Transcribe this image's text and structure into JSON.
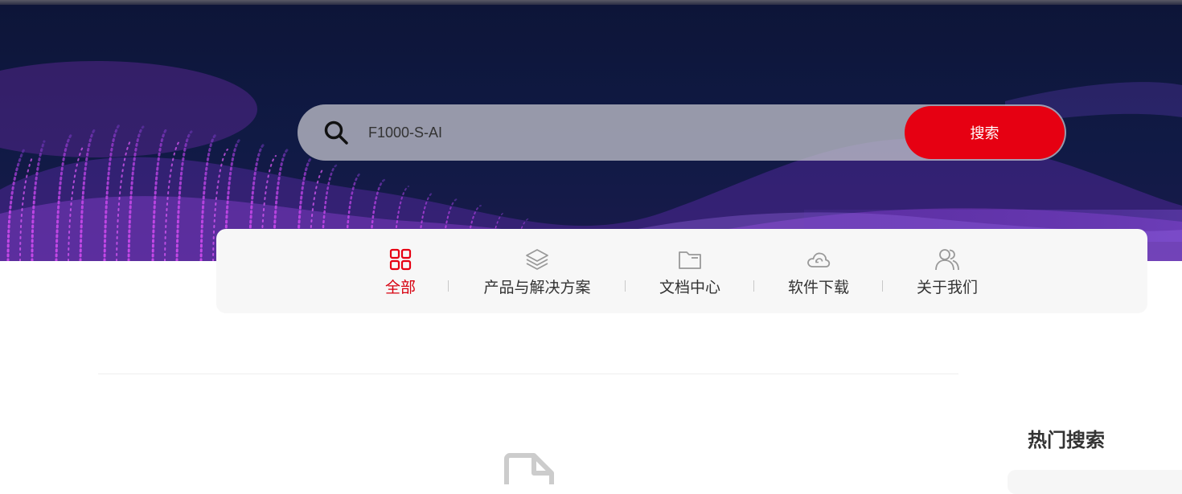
{
  "search": {
    "value": "F1000-S-AI",
    "button_label": "搜索",
    "icon": "search-icon"
  },
  "tabs": [
    {
      "label": "全部",
      "icon": "grid-icon",
      "active": true
    },
    {
      "label": "产品与解决方案",
      "icon": "layers-icon",
      "active": false
    },
    {
      "label": "文档中心",
      "icon": "folder-icon",
      "active": false
    },
    {
      "label": "软件下载",
      "icon": "cloud-download-icon",
      "active": false
    },
    {
      "label": "关于我们",
      "icon": "users-icon",
      "active": false
    }
  ],
  "sidebar": {
    "hot_search_title": "热门搜索"
  },
  "colors": {
    "accent": "#e60012",
    "active_tab": "#d7000f",
    "hero_bg": "#0d1538",
    "wave": "#c93be0"
  }
}
